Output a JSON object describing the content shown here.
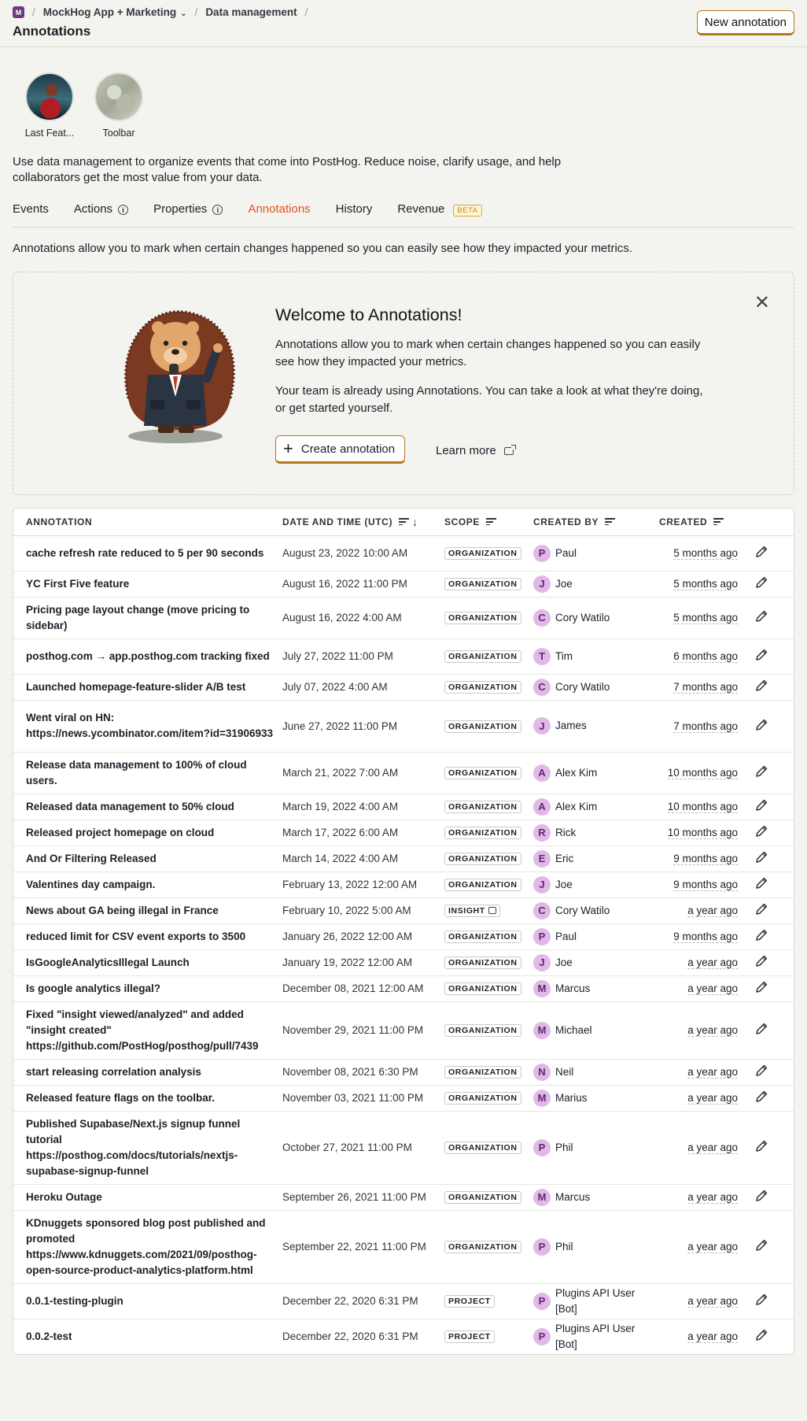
{
  "breadcrumb": {
    "org_initial": "M",
    "project": "MockHog App + Marketing",
    "section": "Data management"
  },
  "page_title": "Annotations",
  "new_annotation_label": "New annotation",
  "shortcuts": [
    {
      "label": "Last Feat..."
    },
    {
      "label": "Toolbar"
    }
  ],
  "description": "Use data management to organize events that come into PostHog. Reduce noise, clarify usage, and help collaborators get the most value from your data.",
  "tabs": [
    {
      "label": "Events"
    },
    {
      "label": "Actions"
    },
    {
      "label": "Properties"
    },
    {
      "label": "Annotations"
    },
    {
      "label": "History"
    },
    {
      "label": "Revenue",
      "badge": "BETA"
    }
  ],
  "intro": "Annotations allow you to mark when certain changes happened so you can easily see how they impacted your metrics.",
  "welcome": {
    "title": "Welcome to Annotations!",
    "p1": "Annotations allow you to mark when certain changes happened so you can easily see how they impacted your metrics.",
    "p2": "Your team is already using Annotations. You can take a look at what they're doing, or get started yourself.",
    "create_label": "Create annotation",
    "learn_more_label": "Learn more"
  },
  "table": {
    "headers": {
      "annotation": "ANNOTATION",
      "date": "DATE AND TIME (UTC)",
      "scope": "SCOPE",
      "created_by": "CREATED BY",
      "created": "CREATED"
    },
    "rows": [
      {
        "annotation": "cache refresh rate reduced to 5 per 90 seconds",
        "date": "August 23, 2022 10:00 AM",
        "scope": "ORGANIZATION",
        "initial": "P",
        "creator": "Paul",
        "created": "5 months ago"
      },
      {
        "annotation": "YC First Five feature",
        "date": "August 16, 2022 11:00 PM",
        "scope": "ORGANIZATION",
        "initial": "J",
        "creator": "Joe",
        "created": "5 months ago"
      },
      {
        "annotation": "Pricing page layout change (move pricing to sidebar)",
        "date": "August 16, 2022 4:00 AM",
        "scope": "ORGANIZATION",
        "initial": "C",
        "creator": "Cory Watilo",
        "created": "5 months ago"
      },
      {
        "annotation": "posthog.com → app.posthog.com tracking fixed",
        "date": "July 27, 2022 11:00 PM",
        "scope": "ORGANIZATION",
        "initial": "T",
        "creator": "Tim",
        "created": "6 months ago"
      },
      {
        "annotation": "Launched homepage-feature-slider A/B test",
        "date": "July 07, 2022 4:00 AM",
        "scope": "ORGANIZATION",
        "initial": "C",
        "creator": "Cory Watilo",
        "created": "7 months ago"
      },
      {
        "annotation": "Went viral on HN: https://news.ycombinator.com/item?id=31906933",
        "date": "June 27, 2022 11:00 PM",
        "scope": "ORGANIZATION",
        "initial": "J",
        "creator": "James",
        "created": "7 months ago"
      },
      {
        "annotation": "Release data management to 100% of cloud users.",
        "date": "March 21, 2022 7:00 AM",
        "scope": "ORGANIZATION",
        "initial": "A",
        "creator": "Alex Kim",
        "created": "10 months ago"
      },
      {
        "annotation": "Released data management to 50% cloud",
        "date": "March 19, 2022 4:00 AM",
        "scope": "ORGANIZATION",
        "initial": "A",
        "creator": "Alex Kim",
        "created": "10 months ago"
      },
      {
        "annotation": "Released project homepage on cloud",
        "date": "March 17, 2022 6:00 AM",
        "scope": "ORGANIZATION",
        "initial": "R",
        "creator": "Rick",
        "created": "10 months ago"
      },
      {
        "annotation": "And Or Filtering Released",
        "date": "March 14, 2022 4:00 AM",
        "scope": "ORGANIZATION",
        "initial": "E",
        "creator": "Eric",
        "created": "9 months ago"
      },
      {
        "annotation": "Valentines day campaign.",
        "date": "February 13, 2022 12:00 AM",
        "scope": "ORGANIZATION",
        "initial": "J",
        "creator": "Joe",
        "created": "9 months ago"
      },
      {
        "annotation": "News about GA being illegal in France",
        "date": "February 10, 2022 5:00 AM",
        "scope": "INSIGHT",
        "scope_link": true,
        "initial": "C",
        "creator": "Cory Watilo",
        "created": "a year ago"
      },
      {
        "annotation": "reduced limit for CSV event exports to 3500",
        "date": "January 26, 2022 12:00 AM",
        "scope": "ORGANIZATION",
        "initial": "P",
        "creator": "Paul",
        "created": "9 months ago"
      },
      {
        "annotation": "IsGoogleAnalyticsIllegal Launch",
        "date": "January 19, 2022 12:00 AM",
        "scope": "ORGANIZATION",
        "initial": "J",
        "creator": "Joe",
        "created": "a year ago"
      },
      {
        "annotation": "Is google analytics illegal?",
        "date": "December 08, 2021 12:00 AM",
        "scope": "ORGANIZATION",
        "initial": "M",
        "creator": "Marcus",
        "created": "a year ago"
      },
      {
        "annotation": "Fixed \"insight viewed/analyzed\" and added \"insight created\" https://github.com/PostHog/posthog/pull/7439",
        "date": "November 29, 2021 11:00 PM",
        "scope": "ORGANIZATION",
        "initial": "M",
        "creator": "Michael",
        "created": "a year ago"
      },
      {
        "annotation": "start releasing correlation analysis",
        "date": "November 08, 2021 6:30 PM",
        "scope": "ORGANIZATION",
        "initial": "N",
        "creator": "Neil",
        "created": "a year ago"
      },
      {
        "annotation": "Released feature flags on the toolbar.",
        "date": "November 03, 2021 11:00 PM",
        "scope": "ORGANIZATION",
        "initial": "M",
        "creator": "Marius",
        "created": "a year ago"
      },
      {
        "annotation": "Published Supabase/Next.js signup funnel tutorial https://posthog.com/docs/tutorials/nextjs-supabase-signup-funnel",
        "date": "October 27, 2021 11:00 PM",
        "scope": "ORGANIZATION",
        "initial": "P",
        "creator": "Phil",
        "created": "a year ago"
      },
      {
        "annotation": "Heroku Outage",
        "date": "September 26, 2021 11:00 PM",
        "scope": "ORGANIZATION",
        "initial": "M",
        "creator": "Marcus",
        "created": "a year ago"
      },
      {
        "annotation": "KDnuggets sponsored blog post published and promoted https://www.kdnuggets.com/2021/09/posthog-open-source-product-analytics-platform.html",
        "date": "September 22, 2021 11:00 PM",
        "scope": "ORGANIZATION",
        "initial": "P",
        "creator": "Phil",
        "created": "a year ago"
      },
      {
        "annotation": "0.0.1-testing-plugin",
        "date": "December 22, 2020 6:31 PM",
        "scope": "PROJECT",
        "initial": "P",
        "creator": "Plugins API User [Bot]",
        "created": "a year ago"
      },
      {
        "annotation": "0.0.2-test",
        "date": "December 22, 2020 6:31 PM",
        "scope": "PROJECT",
        "initial": "P",
        "creator": "Plugins API User [Bot]",
        "created": "a year ago"
      }
    ]
  }
}
